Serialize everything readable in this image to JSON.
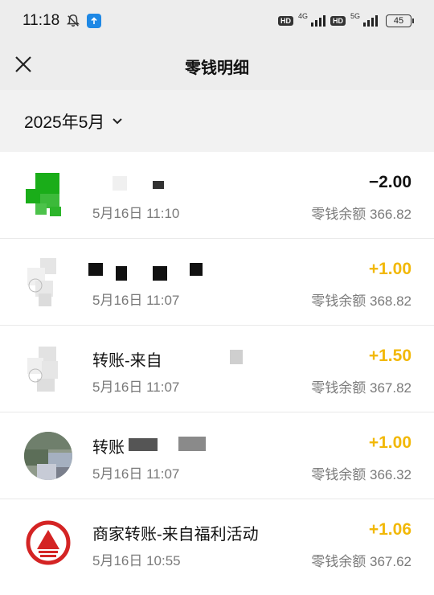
{
  "status": {
    "time": "11:18",
    "net1": "4G",
    "net2": "5G",
    "hd": "HD",
    "battery": "45"
  },
  "header": {
    "title": "零钱明细"
  },
  "filter": {
    "month": "2025年5月"
  },
  "colors": {
    "positive": "#f2b807",
    "negative": "#111111",
    "logo_red": "#d42424",
    "avatar_green": "#1aad19"
  },
  "transactions": [
    {
      "title": "",
      "date": "5月16日 11:10",
      "amount": "−2.00",
      "balance": "零钱余额 366.82",
      "icon": "green-avatar-icon"
    },
    {
      "title": "",
      "date": "5月16日 11:07",
      "amount": "+1.00",
      "balance": "零钱余额 368.82",
      "icon": "user-avatar-icon"
    },
    {
      "title": "转账-来自",
      "date": "5月16日 11:07",
      "amount": "+1.50",
      "balance": "零钱余额 367.82",
      "icon": "user-avatar-icon"
    },
    {
      "title": "转账",
      "date": "5月16日 11:07",
      "amount": "+1.00",
      "balance": "零钱余额 366.32",
      "icon": "photo-avatar-icon"
    },
    {
      "title": "商家转账-来自福利活动",
      "date": "5月16日 10:55",
      "amount": "+1.06",
      "balance": "零钱余额 367.62",
      "icon": "merchant-logo-icon"
    }
  ]
}
